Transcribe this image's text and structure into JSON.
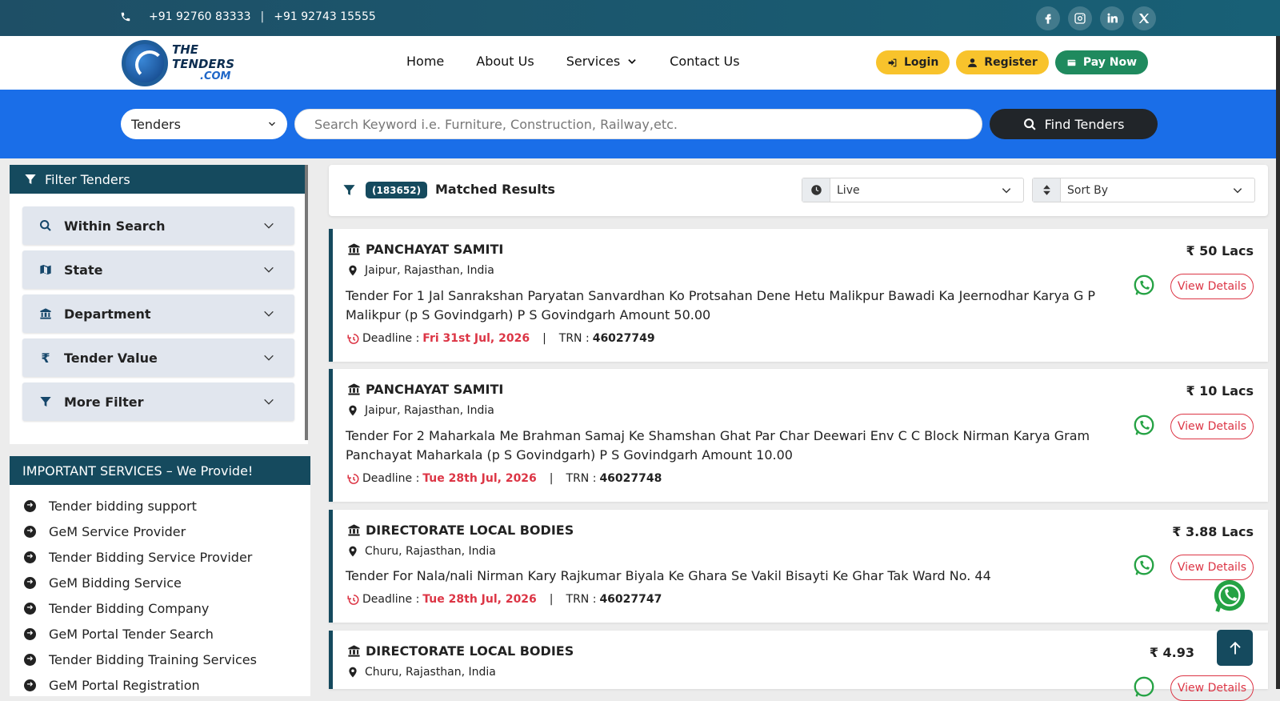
{
  "topbar": {
    "phone1": "+91 92760 83333",
    "separator": "|",
    "phone2": "+91 92743 15555",
    "social": [
      "facebook-icon",
      "instagram-icon",
      "linkedin-icon",
      "x-icon"
    ]
  },
  "header": {
    "logo_line1": "THE",
    "logo_line2": "TENDERS",
    "logo_line3": ".COM",
    "nav": [
      {
        "label": "Home"
      },
      {
        "label": "About Us"
      },
      {
        "label": "Services"
      },
      {
        "label": "Contact Us"
      }
    ],
    "login": "Login",
    "register": "Register",
    "pay_now": "Pay Now"
  },
  "search": {
    "type_selected": "Tenders",
    "placeholder": "Search Keyword i.e. Furniture, Construction, Railway,etc.",
    "button": "Find Tenders"
  },
  "filters": {
    "title": "Filter Tenders",
    "items": [
      {
        "label": "Within Search",
        "icon": "search-icon"
      },
      {
        "label": "State",
        "icon": "map-icon"
      },
      {
        "label": "Department",
        "icon": "bank-icon"
      },
      {
        "label": "Tender Value",
        "icon": "rupee-icon"
      },
      {
        "label": "More Filter",
        "icon": "filter-icon"
      }
    ]
  },
  "services": {
    "title": "IMPORTANT SERVICES – We Provide!",
    "items": [
      "Tender bidding support",
      "GeM Service Provider",
      "Tender Bidding Service Provider",
      "GeM Bidding Service",
      "Tender Bidding Company",
      "GeM Portal Tender Search",
      "Tender Bidding Training Services",
      "GeM Portal Registration"
    ]
  },
  "results": {
    "count": "(183652)",
    "label": "Matched Results",
    "status_selected": "Live",
    "sort_selected": "Sort By",
    "deadline_label": "Deadline :",
    "trn_label": "TRN :",
    "view_label": "View Details",
    "cards": [
      {
        "dept": "PANCHAYAT SAMITI",
        "location": "Jaipur, Rajasthan, India",
        "title": "Tender For 1 Jal Sanrakshan Paryatan Sanvardhan Ko Protsahan Dene Hetu Malikpur Bawadi Ka Jeernodhar Karya G P Malikpur (p S Govindgarh) P S Govindgarh Amount 50.00",
        "deadline": "Fri 31st Jul, 2026",
        "trn": "46027749",
        "value": "₹ 50 Lacs"
      },
      {
        "dept": "PANCHAYAT SAMITI",
        "location": "Jaipur, Rajasthan, India",
        "title": "Tender For 2 Maharkala Me Brahman Samaj Ke Shamshan Ghat Par Char Deewari Env C C Block Nirman Karya Gram Panchayat Maharkala (p S Govindgarh) P S Govindgarh Amount 10.00",
        "deadline": "Tue 28th Jul, 2026",
        "trn": "46027748",
        "value": "₹ 10 Lacs"
      },
      {
        "dept": "DIRECTORATE LOCAL BODIES",
        "location": "Churu, Rajasthan, India",
        "title": "Tender For Nala/nali Nirman Kary Rajkumar Biyala Ke Ghara Se Vakil Bisayti Ke Ghar Tak Ward No. 44",
        "deadline": "Tue 28th Jul, 2026",
        "trn": "46027747",
        "value": "₹ 3.88 Lacs"
      },
      {
        "dept": "DIRECTORATE LOCAL BODIES",
        "location": "Churu, Rajasthan, India",
        "title": "",
        "deadline": "",
        "trn": "",
        "value": "₹ 4.93"
      }
    ]
  },
  "colors": {
    "primary": "#154a5e",
    "search_band": "#1a6ee8",
    "accent_yellow": "#f8c32c",
    "accent_green": "#1f8a5e",
    "deadline_red": "#dc3545"
  }
}
